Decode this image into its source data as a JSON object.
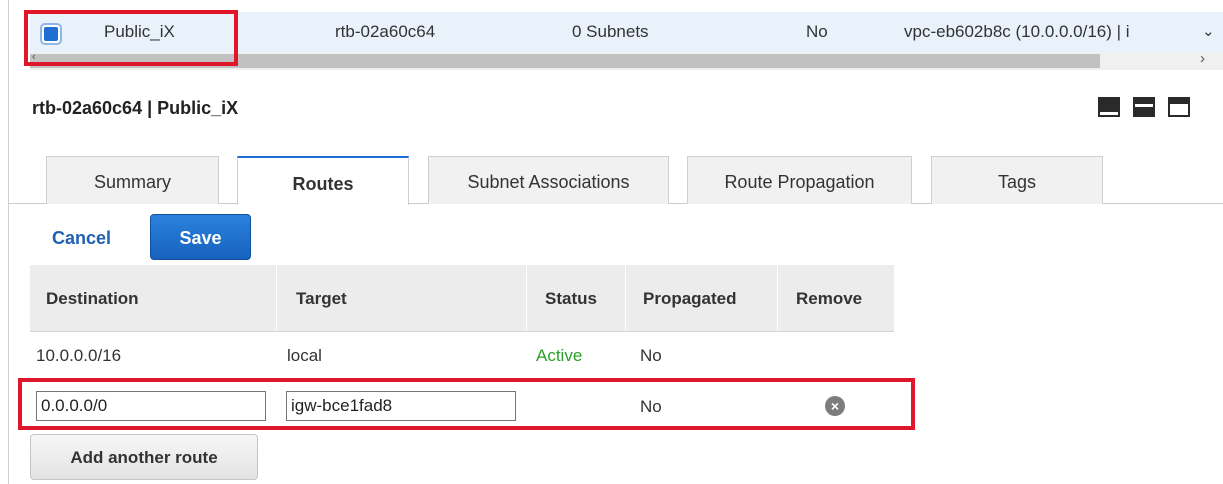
{
  "route_table_row": {
    "name": "Public_iX",
    "id": "rtb-02a60c64",
    "subnets": "0 Subnets",
    "main": "No",
    "vpc": "vpc-eb602b8c (10.0.0.0/16) | i",
    "selected": true
  },
  "details": {
    "title": "rtb-02a60c64 | Public_iX"
  },
  "tabs": [
    {
      "label": "Summary",
      "active": false
    },
    {
      "label": "Routes",
      "active": true
    },
    {
      "label": "Subnet Associations",
      "active": false
    },
    {
      "label": "Route Propagation",
      "active": false
    },
    {
      "label": "Tags",
      "active": false
    }
  ],
  "actions": {
    "cancel_label": "Cancel",
    "save_label": "Save"
  },
  "routes_table": {
    "headers": [
      "Destination",
      "Target",
      "Status",
      "Propagated",
      "Remove"
    ],
    "rows": [
      {
        "destination": "10.0.0.0/16",
        "target": "local",
        "status": "Active",
        "propagated": "No"
      }
    ],
    "edit_row": {
      "destination": "0.0.0.0/0",
      "target": "igw-bce1fad8",
      "propagated": "No"
    }
  },
  "add_route_label": "Add another route",
  "colors": {
    "accent": "#1f6ed4",
    "status_active": "#2ca02c",
    "highlight_box": "#e0162b"
  },
  "icons": {
    "checkbox": "checkbox-checked-icon",
    "dropdown": "chevron-down-icon",
    "scroll_left": "chevron-left-icon",
    "scroll_right": "chevron-right-icon",
    "remove": "remove-circle-icon",
    "layouts": [
      "layout-bottom-icon",
      "layout-split-icon",
      "layout-top-icon"
    ]
  }
}
